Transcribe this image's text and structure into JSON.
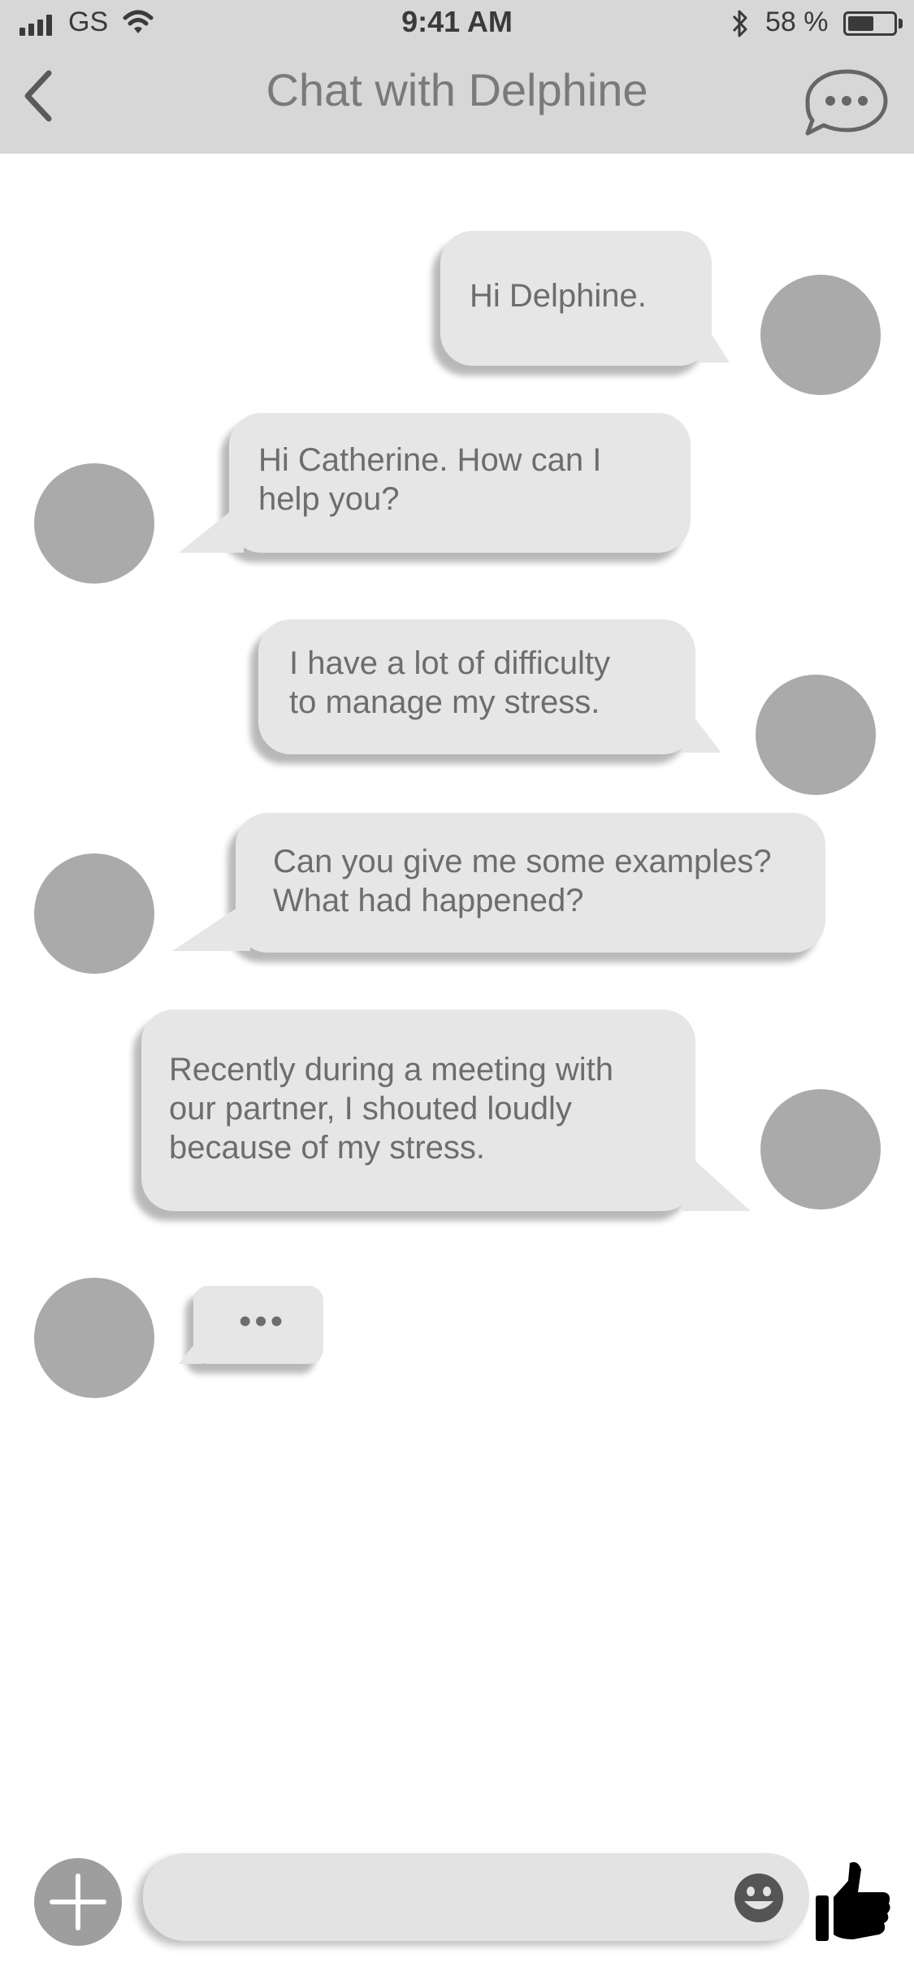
{
  "status_bar": {
    "carrier": "GS",
    "time": "9:41 AM",
    "battery_percent": "58 %",
    "battery_level": 0.58
  },
  "header": {
    "title": "Chat with Delphine",
    "back_icon": "chevron-left-icon",
    "chat_icon": "speech-bubble-dots-icon"
  },
  "messages": [
    {
      "from": "Catherine",
      "side": "right",
      "text": "Hi Delphine."
    },
    {
      "from": "Delphine",
      "side": "left",
      "text": "Hi Catherine. How can I\nhelp you?"
    },
    {
      "from": "Catherine",
      "side": "right",
      "text": " I have a lot of difficulty\nto manage my stress."
    },
    {
      "from": "Delphine",
      "side": "left",
      "text": "Can you give me some examples?\nWhat had happened?"
    },
    {
      "from": "Catherine",
      "side": "right",
      "text": "Recently during a meeting with\nour partner, I shouted loudly\nbecause of my stress."
    },
    {
      "from": "Delphine",
      "side": "left",
      "typing": "•••"
    }
  ],
  "composer": {
    "value": "",
    "placeholder": "",
    "add_icon": "plus-icon",
    "emoji_icon": "smiley-icon",
    "like_icon": "thumbs-up-icon"
  },
  "colors": {
    "header_bg": "#d7d7d7",
    "bubble_bg": "#e6e6e6",
    "avatar": "#aaaaaa",
    "text": "#6d6d6d"
  }
}
